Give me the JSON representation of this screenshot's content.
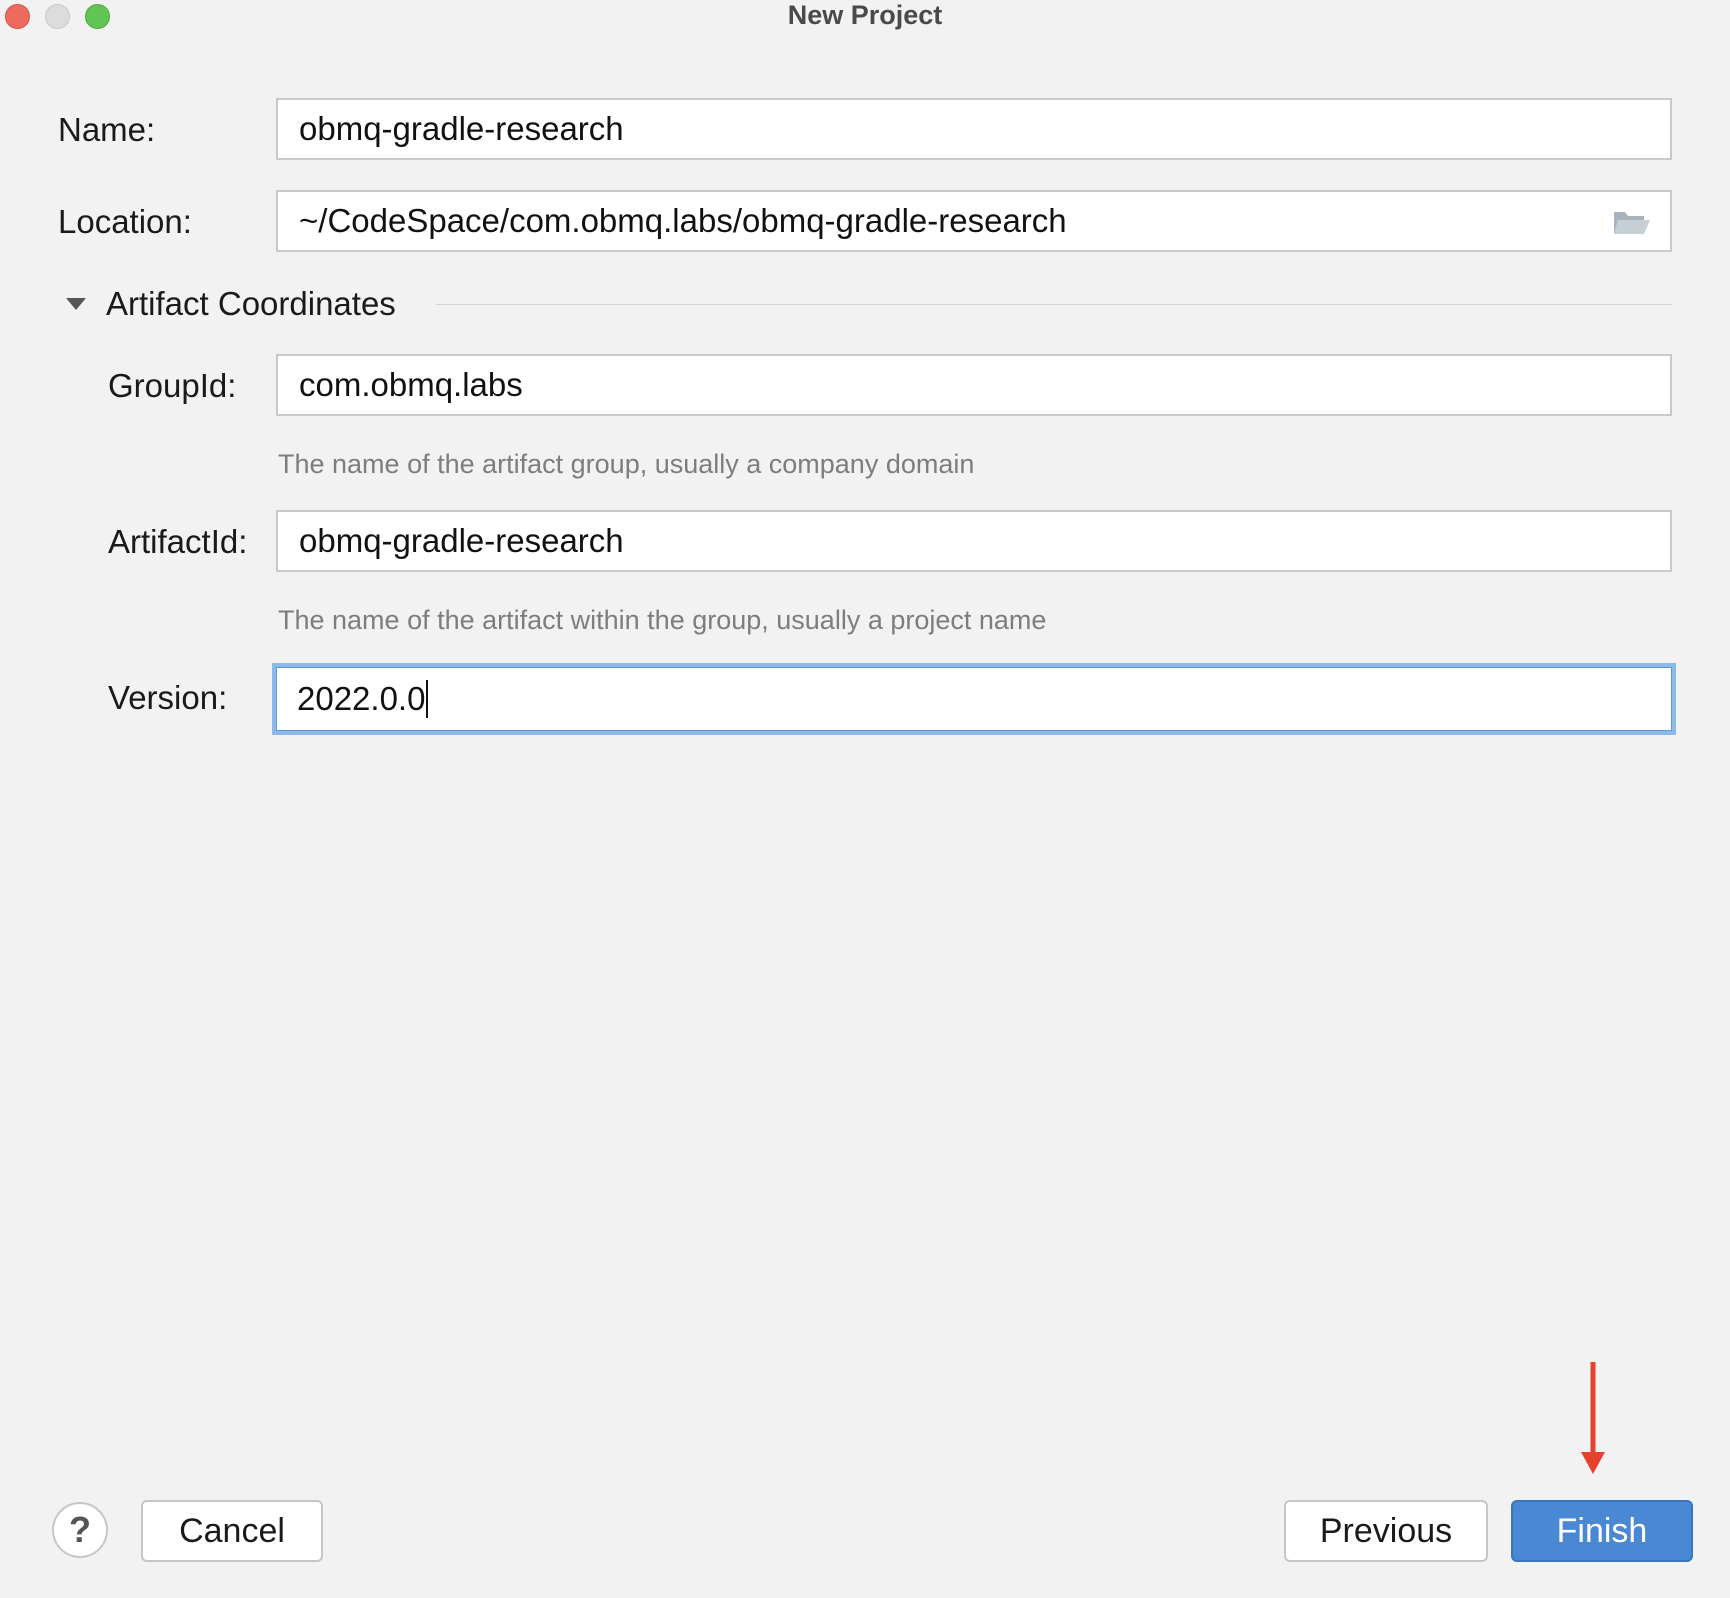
{
  "window": {
    "title": "New Project"
  },
  "form": {
    "name": {
      "label": "Name:",
      "value": "obmq-gradle-research"
    },
    "location": {
      "label": "Location:",
      "value": "~/CodeSpace/com.obmq.labs/obmq-gradle-research"
    },
    "section": {
      "title": "Artifact Coordinates",
      "expanded": true
    },
    "group_id": {
      "label": "GroupId:",
      "value": "com.obmq.labs",
      "hint": "The name of the artifact group, usually a company domain"
    },
    "artifact_id": {
      "label": "ArtifactId:",
      "value": "obmq-gradle-research",
      "hint": "The name of the artifact within the group, usually a project name"
    },
    "version": {
      "label": "Version:",
      "value": "2022.0.0",
      "focused": true
    }
  },
  "footer": {
    "help_label": "?",
    "cancel_label": "Cancel",
    "previous_label": "Previous",
    "finish_label": "Finish"
  },
  "colors": {
    "background": "#f2f2f2",
    "primary_button": "#4a88d4",
    "focus_ring": "#8db9ea",
    "annotation_arrow": "#e8402e"
  },
  "icons": {
    "folder": "folder-open-icon",
    "section_toggle": "triangle-down-icon"
  }
}
